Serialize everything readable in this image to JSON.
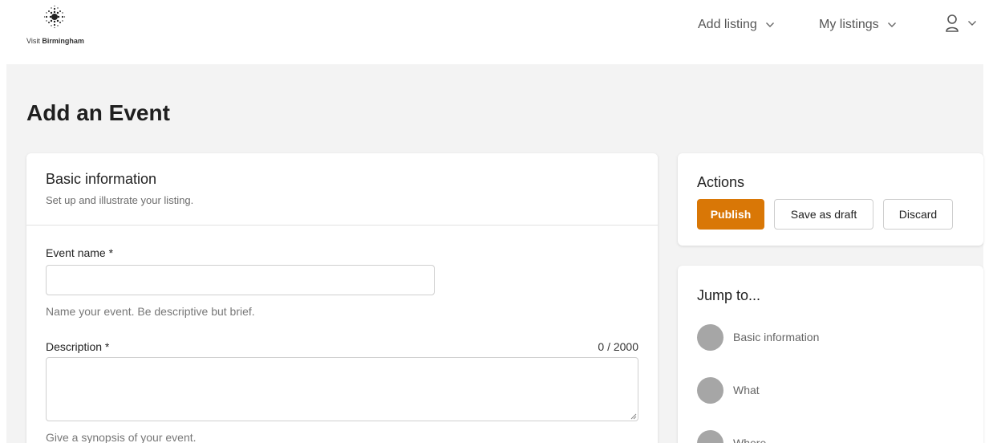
{
  "header": {
    "logo_text_prefix": "Visit ",
    "logo_text_brand": "Birmingham",
    "nav": {
      "add_listing": "Add listing",
      "my_listings": "My listings"
    }
  },
  "page": {
    "title": "Add an Event"
  },
  "basic_info": {
    "title": "Basic information",
    "subtitle": "Set up and illustrate your listing.",
    "event_name": {
      "label": "Event name *",
      "value": "",
      "hint": "Name your event. Be descriptive but brief."
    },
    "description": {
      "label": "Description *",
      "value": "",
      "counter": "0 / 2000",
      "hint": "Give a synopsis of your event."
    }
  },
  "actions": {
    "title": "Actions",
    "publish": "Publish",
    "save_draft": "Save as draft",
    "discard": "Discard"
  },
  "jump_to": {
    "title": "Jump to...",
    "items": [
      {
        "label": "Basic information"
      },
      {
        "label": "What"
      },
      {
        "label": "Where"
      }
    ]
  },
  "colors": {
    "accent": "#d97706",
    "background": "#f3f3f3",
    "jump_dot": "#a6a6a6"
  },
  "icons": [
    "logo-icon",
    "chevron-down-icon",
    "user-icon",
    "resize-grip-icon"
  ]
}
